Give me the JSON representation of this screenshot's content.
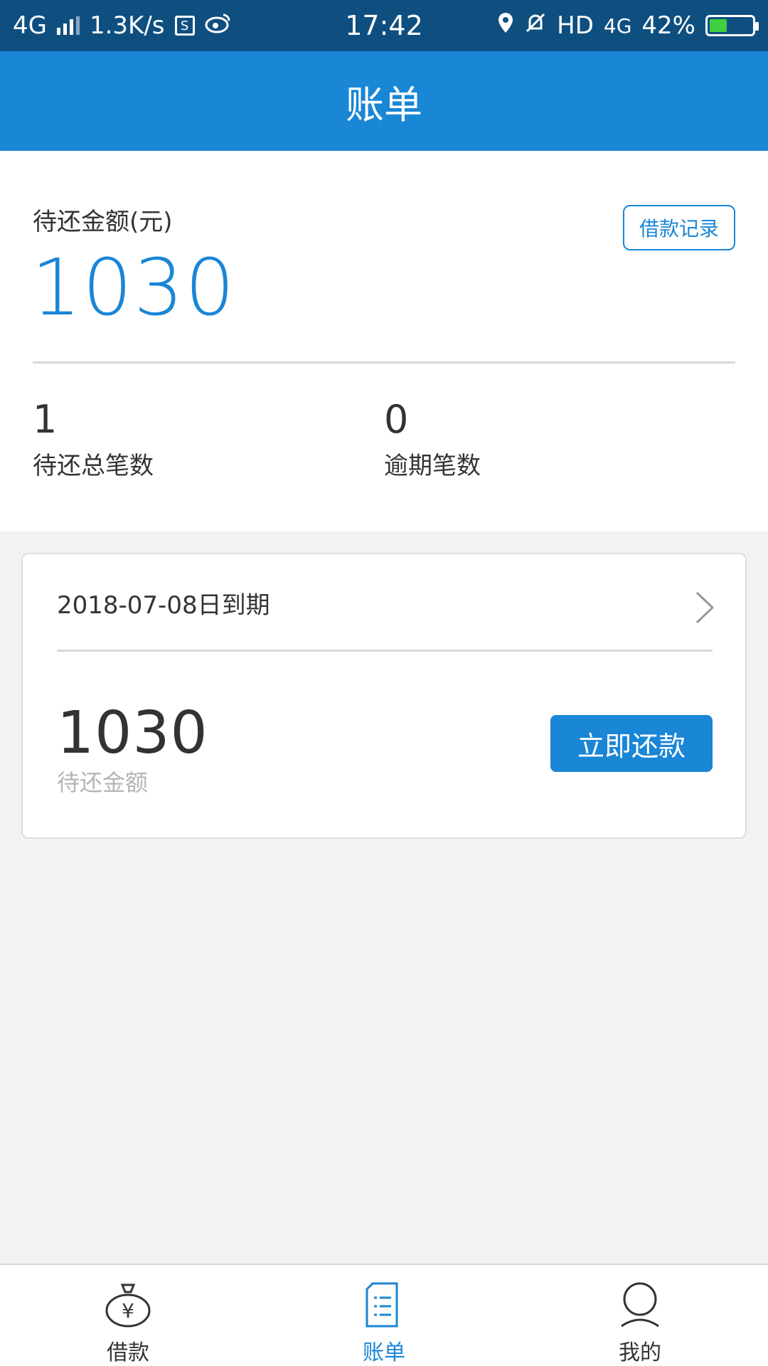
{
  "status_bar": {
    "network": "4G",
    "speed": "1.3K/s",
    "time": "17:42",
    "hd": "HD",
    "network2": "4G",
    "battery": "42%",
    "icons": [
      "signal-icon",
      "s-app-icon",
      "weibo-icon",
      "location-icon",
      "mute-icon",
      "battery-icon"
    ]
  },
  "header": {
    "title": "账单"
  },
  "summary": {
    "pending_label": "待还金额(元)",
    "pending_amount": "1030",
    "record_button": "借款记录",
    "stats": [
      {
        "value": "1",
        "label": "待还总笔数"
      },
      {
        "value": "0",
        "label": "逾期笔数"
      }
    ]
  },
  "bill_card": {
    "due_text": "2018-07-08日到期",
    "amount": "1030",
    "amount_label": "待还金额",
    "pay_button": "立即还款"
  },
  "bottom_nav": {
    "items": [
      {
        "label": "借款",
        "icon": "money-bag-icon",
        "active": false
      },
      {
        "label": "账单",
        "icon": "bill-icon",
        "active": true
      },
      {
        "label": "我的",
        "icon": "user-icon",
        "active": false
      }
    ]
  },
  "colors": {
    "accent": "#1a86d6",
    "status_bar": "#0f4f80",
    "background": "#f2f2f2"
  }
}
